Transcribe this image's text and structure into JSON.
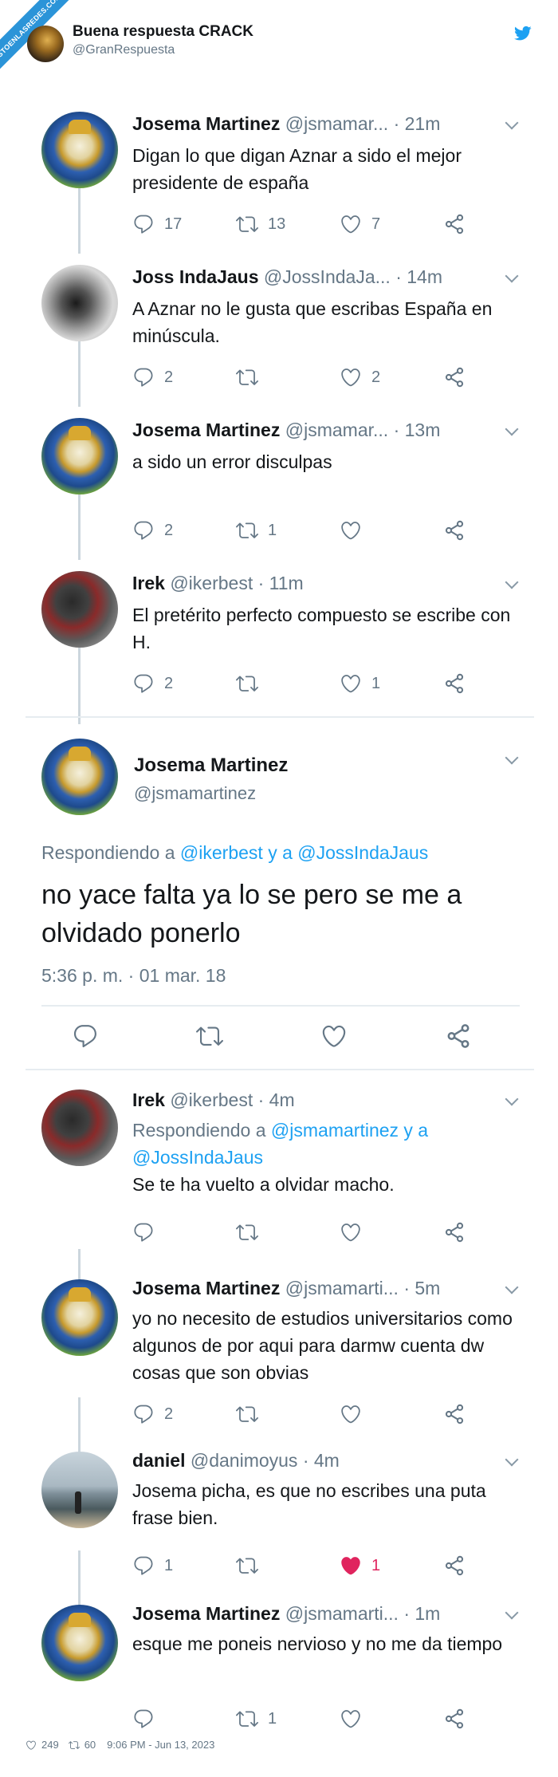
{
  "header": {
    "ribbon": "VISTOENLASREDES.COM",
    "account_name": "Buena respuesta CRACK",
    "account_handle": "@GranRespuesta"
  },
  "tweets": [
    {
      "name": "Josema Martinez",
      "handle": "@jsmamar...",
      "time": "· 21m",
      "text": "Digan lo que digan  Aznar a sido el mejor presidente de españa",
      "replies": "17",
      "retweets": "13",
      "likes": "7",
      "liked": false,
      "avatar": "real-madrid-crest"
    },
    {
      "name": "Joss IndaJaus",
      "handle": "@JossIndaJa...",
      "time": "· 14m",
      "text": "A Aznar no le gusta que escribas España en minúscula.",
      "replies": "2",
      "retweets": "",
      "likes": "2",
      "liked": false,
      "avatar": "machine-photo"
    },
    {
      "name": "Josema Martinez",
      "handle": "@jsmamar...",
      "time": "· 13m",
      "text": "a sido un error disculpas",
      "replies": "2",
      "retweets": "1",
      "likes": "",
      "liked": false,
      "avatar": "real-madrid-crest"
    },
    {
      "name": "Irek",
      "handle": "@ikerbest",
      "time": "· 11m",
      "text": "El pretérito perfecto compuesto se escribe con H.",
      "replies": "2",
      "retweets": "",
      "likes": "1",
      "liked": false,
      "avatar": "helmet-photo"
    }
  ],
  "main_tweet": {
    "name": "Josema Martinez",
    "handle": "@jsmamartinez",
    "reply_prefix": "Respondiendo a ",
    "reply_to": "@ikerbest y a @JossIndaJaus",
    "text": "no yace falta ya lo se pero se me a olvidado ponerlo",
    "timestamp": "5:36 p. m. · 01 mar. 18"
  },
  "replies": [
    {
      "name": "Irek",
      "handle": "@ikerbest",
      "time": "· 4m",
      "reply_prefix": "Respondiendo a ",
      "reply_to": "@jsmamartinez y a @JossIndaJaus",
      "text": "Se te ha vuelto a olvidar macho.",
      "replies": "",
      "retweets": "",
      "likes": "",
      "liked": false,
      "avatar": "helmet-photo"
    },
    {
      "name": "Josema Martinez",
      "handle": "@jsmamarti...",
      "time": "· 5m",
      "text": "yo no necesito de estudios universitarios como algunos de por aqui para darmw cuenta dw cosas que son obvias",
      "replies": "2",
      "retweets": "",
      "likes": "",
      "liked": false,
      "avatar": "real-madrid-crest"
    },
    {
      "name": "daniel",
      "handle": "@danimoyus",
      "time": "· 4m",
      "text": "Josema picha, es que no escribes una puta frase bien.",
      "replies": "1",
      "retweets": "",
      "likes": "1",
      "liked": true,
      "avatar": "beach-photo"
    },
    {
      "name": "Josema Martinez",
      "handle": "@jsmamarti...",
      "time": "· 1m",
      "text": "esque me poneis nervioso y no me da tiempo",
      "replies": "",
      "retweets": "1",
      "likes": "",
      "liked": false,
      "avatar": "real-madrid-crest"
    }
  ],
  "footer": {
    "likes": "249",
    "retweets": "60",
    "date": "9:06 PM - Jun 13, 2023"
  },
  "colors": {
    "accent": "#1da1f2",
    "muted": "#657786",
    "like_red": "#e0245e",
    "ribbon": "#2b94d8"
  }
}
